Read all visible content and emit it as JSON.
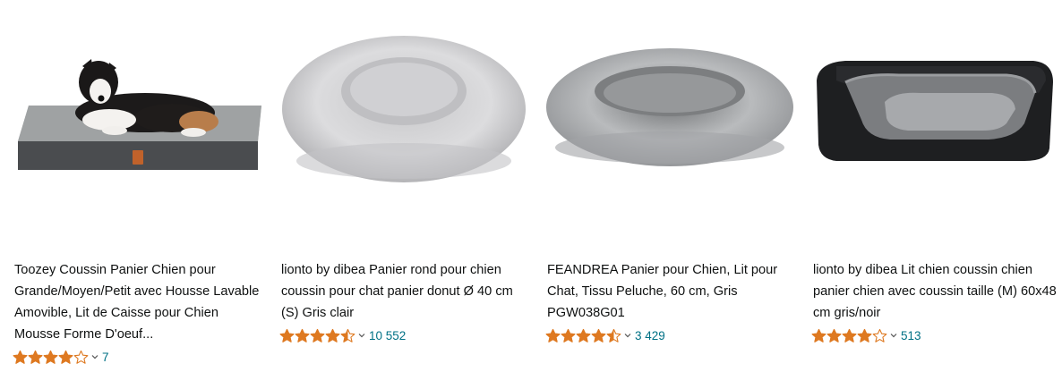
{
  "products": [
    {
      "title": "Toozey Coussin Panier Chien pour Grande/Moyen/Petit avec Housse Lavable Amovible, Lit de Caisse pour Chien Mousse Forme D'oeuf...",
      "rating": 4.0,
      "reviews": "7",
      "image": "gray-orthopedic-dog-bed-with-dog"
    },
    {
      "title": "lionto by dibea Panier rond pour chien coussin pour chat panier donut Ø 40 cm (S) Gris clair",
      "rating": 4.5,
      "reviews": "10 552",
      "image": "light-gray-fluffy-donut-bed"
    },
    {
      "title": "FEANDREA Panier pour Chien, Lit pour Chat, Tissu Peluche, 60 cm, Gris PGW038G01",
      "rating": 4.5,
      "reviews": "3 429",
      "image": "frosted-gray-plush-donut-bed"
    },
    {
      "title": "lionto by dibea Lit chien coussin chien panier chien avec coussin taille (M) 60x48 cm gris/noir",
      "rating": 4.0,
      "reviews": "513",
      "image": "black-gray-rectangular-dog-bed"
    }
  ],
  "colors": {
    "star": "#de7921",
    "link": "#007185",
    "text": "#0f1111"
  },
  "icons": {
    "star_full": "star-full-icon",
    "star_half": "star-half-icon",
    "star_empty": "star-empty-icon",
    "chevron": "chevron-down-icon"
  }
}
